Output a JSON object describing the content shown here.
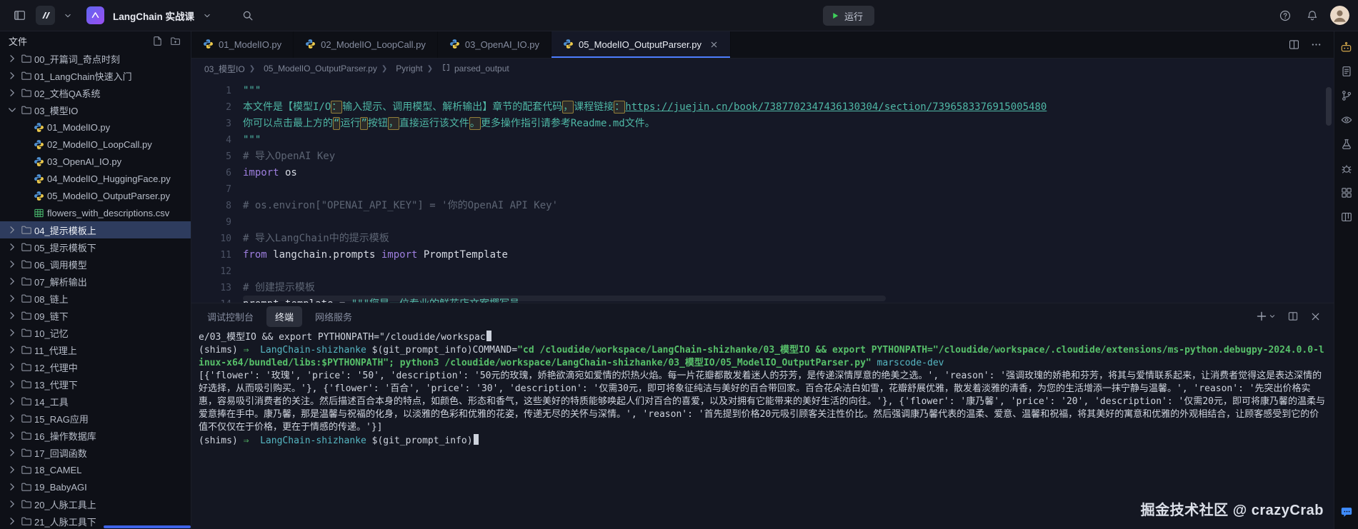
{
  "titlebar": {
    "project_name": "LangChain 实战课",
    "run_label": "运行"
  },
  "explorer": {
    "title": "文件",
    "items": [
      {
        "label": "00_开篇词_奇点时刻",
        "icon": "folder",
        "level": 0,
        "chevron": "right"
      },
      {
        "label": "01_LangChain快速入门",
        "icon": "folder",
        "level": 0,
        "chevron": "right"
      },
      {
        "label": "02_文档QA系统",
        "icon": "folder",
        "level": 0,
        "chevron": "right"
      },
      {
        "label": "03_模型IO",
        "icon": "folder",
        "level": 0,
        "chevron": "down"
      },
      {
        "label": "01_ModelIO.py",
        "icon": "python",
        "level": 1
      },
      {
        "label": "02_ModelIO_LoopCall.py",
        "icon": "python",
        "level": 1
      },
      {
        "label": "03_OpenAI_IO.py",
        "icon": "python",
        "level": 1
      },
      {
        "label": "04_ModelIO_HuggingFace.py",
        "icon": "python",
        "level": 1
      },
      {
        "label": "05_ModelIO_OutputParser.py",
        "icon": "python",
        "level": 1
      },
      {
        "label": "flowers_with_descriptions.csv",
        "icon": "csv",
        "level": 1
      },
      {
        "label": "04_提示模板上",
        "icon": "folder",
        "level": 0,
        "chevron": "right",
        "selected": true
      },
      {
        "label": "05_提示模板下",
        "icon": "folder",
        "level": 0,
        "chevron": "right"
      },
      {
        "label": "06_调用模型",
        "icon": "folder",
        "level": 0,
        "chevron": "right"
      },
      {
        "label": "07_解析输出",
        "icon": "folder",
        "level": 0,
        "chevron": "right"
      },
      {
        "label": "08_链上",
        "icon": "folder",
        "level": 0,
        "chevron": "right"
      },
      {
        "label": "09_链下",
        "icon": "folder",
        "level": 0,
        "chevron": "right"
      },
      {
        "label": "10_记忆",
        "icon": "folder",
        "level": 0,
        "chevron": "right"
      },
      {
        "label": "11_代理上",
        "icon": "folder",
        "level": 0,
        "chevron": "right"
      },
      {
        "label": "12_代理中",
        "icon": "folder",
        "level": 0,
        "chevron": "right"
      },
      {
        "label": "13_代理下",
        "icon": "folder",
        "level": 0,
        "chevron": "right"
      },
      {
        "label": "14_工具",
        "icon": "folder",
        "level": 0,
        "chevron": "right"
      },
      {
        "label": "15_RAG应用",
        "icon": "folder",
        "level": 0,
        "chevron": "right"
      },
      {
        "label": "16_操作数据库",
        "icon": "folder",
        "level": 0,
        "chevron": "right"
      },
      {
        "label": "17_回调函数",
        "icon": "folder",
        "level": 0,
        "chevron": "right"
      },
      {
        "label": "18_CAMEL",
        "icon": "folder",
        "level": 0,
        "chevron": "right"
      },
      {
        "label": "19_BabyAGI",
        "icon": "folder",
        "level": 0,
        "chevron": "right"
      },
      {
        "label": "20_人脉工具上",
        "icon": "folder",
        "level": 0,
        "chevron": "right"
      },
      {
        "label": "21_人脉工具下",
        "icon": "folder",
        "level": 0,
        "chevron": "right"
      }
    ]
  },
  "tabs": [
    {
      "label": "01_ModelIO.py"
    },
    {
      "label": "02_ModelIO_LoopCall.py"
    },
    {
      "label": "03_OpenAI_IO.py"
    },
    {
      "label": "05_ModelIO_OutputParser.py",
      "active": true
    }
  ],
  "breadcrumb": [
    "03_模型IO",
    "05_ModelIO_OutputParser.py",
    "Pyright",
    "parsed_output"
  ],
  "editor": {
    "lines": [
      {
        "n": "1",
        "tokens": [
          {
            "t": "\"\"\"",
            "c": "str"
          }
        ]
      },
      {
        "n": "2",
        "tokens": [
          {
            "t": "本文件是【模型I/O",
            "c": "str"
          },
          {
            "t": "：",
            "c": "str box"
          },
          {
            "t": "输入提示、调用模型、解析输出】章节的配套代码",
            "c": "str"
          },
          {
            "t": "，",
            "c": "str box"
          },
          {
            "t": "课程链接",
            "c": "str"
          },
          {
            "t": "：",
            "c": "str box"
          },
          {
            "t": "https://juejin.cn/book/7387702347436130304/section/7396583376915005480",
            "c": "link"
          }
        ]
      },
      {
        "n": "3",
        "tokens": [
          {
            "t": "你可以点击最上方的",
            "c": "str"
          },
          {
            "t": "“",
            "c": "str box"
          },
          {
            "t": "运行",
            "c": "str"
          },
          {
            "t": "”",
            "c": "str box"
          },
          {
            "t": "按钮",
            "c": "str"
          },
          {
            "t": "，",
            "c": "str box"
          },
          {
            "t": "直接运行该文件",
            "c": "str"
          },
          {
            "t": "。",
            "c": "str box"
          },
          {
            "t": "更多操作指引请参考Readme.md文件。",
            "c": "str"
          }
        ]
      },
      {
        "n": "4",
        "tokens": [
          {
            "t": "\"\"\"",
            "c": "str"
          }
        ]
      },
      {
        "n": "5",
        "tokens": [
          {
            "t": "# 导入OpenAI Key",
            "c": "cmt"
          }
        ]
      },
      {
        "n": "6",
        "tokens": [
          {
            "t": "import",
            "c": "kw"
          },
          {
            "t": " os",
            "c": "pln"
          }
        ]
      },
      {
        "n": "7",
        "tokens": []
      },
      {
        "n": "8",
        "tokens": [
          {
            "t": "# os.environ[\"OPENAI_API_KEY\"] = '你的OpenAI API Key'",
            "c": "cmt"
          }
        ]
      },
      {
        "n": "9",
        "tokens": []
      },
      {
        "n": "10",
        "tokens": [
          {
            "t": "# 导入LangChain中的提示模板",
            "c": "cmt"
          }
        ]
      },
      {
        "n": "11",
        "tokens": [
          {
            "t": "from",
            "c": "kw"
          },
          {
            "t": " langchain.prompts ",
            "c": "pln"
          },
          {
            "t": "import",
            "c": "kw"
          },
          {
            "t": " PromptTemplate",
            "c": "pln"
          }
        ]
      },
      {
        "n": "12",
        "tokens": []
      },
      {
        "n": "13",
        "tokens": [
          {
            "t": "# 创建提示模板",
            "c": "cmt"
          }
        ]
      },
      {
        "n": "14",
        "tokens": [
          {
            "t": "prompt_template ",
            "c": "pln"
          },
          {
            "t": "= ",
            "c": "op"
          },
          {
            "t": "\"\"\"您是一位专业的鲜花店文案撰写员。",
            "c": "str"
          }
        ]
      }
    ]
  },
  "terminal": {
    "tabs": [
      "调试控制台",
      "终端",
      "网络服务"
    ],
    "active_tab": "终端",
    "lines": [
      {
        "tokens": [
          {
            "t": "e/03_模型IO && export PYTHONPATH=\"/cloudide/workspac",
            "c": "p"
          },
          {
            "t": "",
            "c": "cursor"
          }
        ]
      },
      {
        "tokens": [
          {
            "t": "(shims) ",
            "c": "p"
          },
          {
            "t": "⇒ ",
            "c": "grn"
          },
          {
            "t": " LangChain-shizhanke ",
            "c": "cyn"
          },
          {
            "t": "$(git_prompt_info)",
            "c": "p"
          },
          {
            "t": "COMMAND=",
            "c": "p"
          },
          {
            "t": "\"cd /cloudide/workspace/LangChain-shizhanke/03_模型IO && export PYTHONPATH=\"/cloudide/workspace/.cloudide/extensions/ms-python.debugpy-2024.0.0-linux-x64/bundled/libs:$PYTHONPATH\"; python3 /cloudide/workspace/LangChain-shizhanke/03_模型IO/05_ModelIO_OutputParser.py\"",
            "c": "grnb"
          },
          {
            "t": " marscode-dev",
            "c": "cyn"
          }
        ]
      },
      {
        "tokens": [
          {
            "t": "[{'flower': '玫瑰', 'price': '50', 'description': '50元的玫瑰，娇艳欲滴宛如爱情的炽热火焰。每一片花瓣都散发着迷人的芬芳，是传递深情厚意的绝美之选。', 'reason': '强调玫瑰的娇艳和芬芳，将其与爱情联系起来，让消费者觉得这是表达深情的好选择，从而吸引购买。'}, {'flower': '百合', 'price': '30', 'description': '仅需30元，即可将象征纯洁与美好的百合带回家。百合花朵洁白如雪，花瓣舒展优雅，散发着淡雅的清香，为您的生活增添一抹宁静与温馨。', 'reason': '先突出价格实惠，容易吸引消费者的关注。然后描述百合本身的特点，如颜色、形态和香气，这些美好的特质能够唤起人们对百合的喜爱，以及对拥有它能带来的美好生活的向往。'}, {'flower': '康乃馨', 'price': '20', 'description': '仅需20元，即可将康乃馨的温柔与爱意捧在手中。康乃馨，那是温馨与祝福的化身，以淡雅的色彩和优雅的花姿，传递无尽的关怀与深情。', 'reason': '首先提到价格20元吸引顾客关注性价比。然后强调康乃馨代表的温柔、爱意、温馨和祝福，将其美好的寓意和优雅的外观相结合，让顾客感受到它的价值不仅仅在于价格，更在于情感的传递。'}]",
            "c": "p"
          }
        ]
      },
      {
        "tokens": [
          {
            "t": "(shims) ",
            "c": "p"
          },
          {
            "t": "⇒ ",
            "c": "grn"
          },
          {
            "t": " LangChain-shizhanke ",
            "c": "cyn"
          },
          {
            "t": "$(git_prompt_info)",
            "c": "p"
          },
          {
            "t": "",
            "c": "cursor"
          }
        ]
      }
    ]
  },
  "activity_bar": {
    "top": [
      "ai-assistant",
      "docs",
      "git-branch",
      "preview",
      "flask",
      "bug",
      "extensions",
      "layout"
    ],
    "bottom": [
      "feedback"
    ]
  },
  "watermark": "掘金技术社区 @ crazyCrab",
  "colors": {
    "accent_blue": "#4d7dff",
    "run_green": "#3ecf5a",
    "terminal_green": "#57c06a",
    "terminal_cyan": "#56b6c2",
    "docstring_teal": "#4fb8a6",
    "keyword_purple": "#9d7ede",
    "comment_grey": "#5d6574",
    "selected_row": "#2e3c5e",
    "amber_icon": "#d2a64b",
    "feedback_blue": "#3f8cff"
  }
}
